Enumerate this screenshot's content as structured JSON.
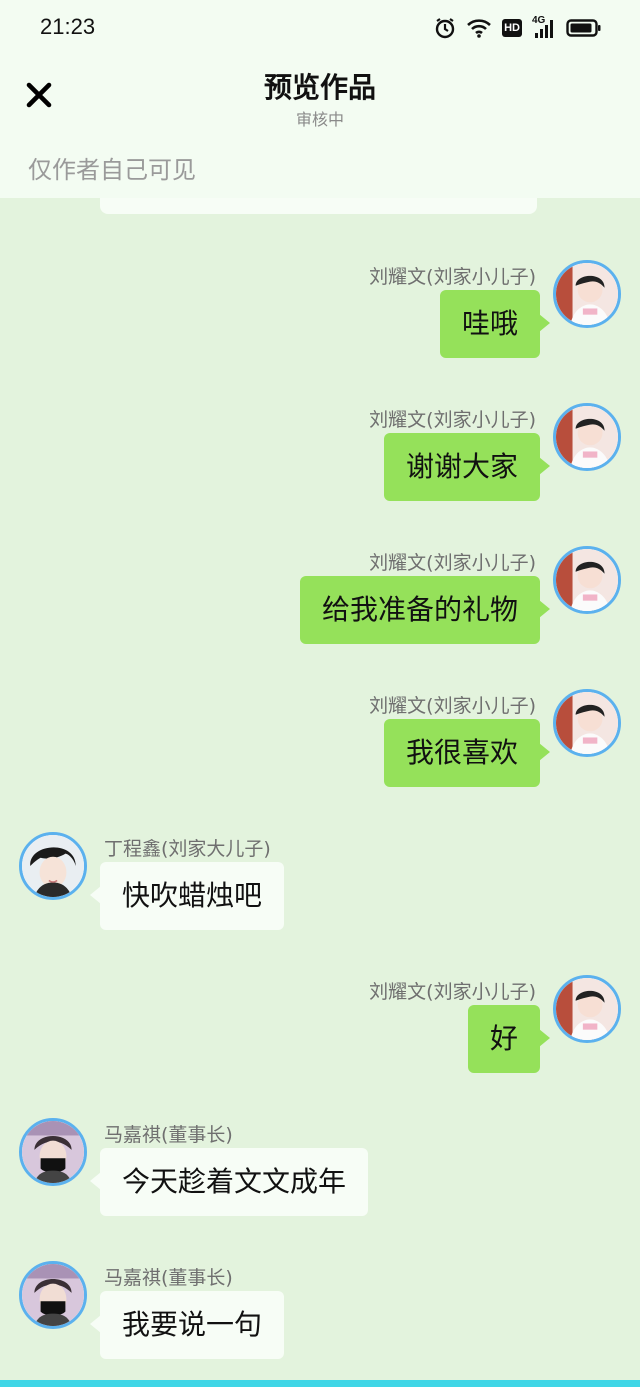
{
  "status_bar": {
    "time": "21:23",
    "icons": [
      "alarm-icon",
      "wifi-icon",
      "hd-icon",
      "4g-signal-icon",
      "battery-icon"
    ],
    "hd_label": "HD",
    "network_label": "4G"
  },
  "header": {
    "title": "预览作品",
    "subtitle": "审核中",
    "close_icon": "close-icon",
    "visibility_note": "仅作者自己可见"
  },
  "colors": {
    "header_bg": "#f3fcf2",
    "chat_bg": "#e3f3dd",
    "own_bubble": "#95e15a",
    "other_bubble": "#f7fdf6",
    "avatar_border": "#5bb1ee",
    "bottom_accent": "#3fd6e6"
  },
  "messages": [
    {
      "side": "right",
      "sender": "刘耀文(刘家小儿子)",
      "text": "哇哦",
      "avatar": "avatar-liu-yaowen"
    },
    {
      "side": "right",
      "sender": "刘耀文(刘家小儿子)",
      "text": "谢谢大家",
      "avatar": "avatar-liu-yaowen"
    },
    {
      "side": "right",
      "sender": "刘耀文(刘家小儿子)",
      "text": "给我准备的礼物",
      "avatar": "avatar-liu-yaowen"
    },
    {
      "side": "right",
      "sender": "刘耀文(刘家小儿子)",
      "text": "我很喜欢",
      "avatar": "avatar-liu-yaowen"
    },
    {
      "side": "left",
      "sender": "丁程鑫(刘家大儿子)",
      "text": "快吹蜡烛吧",
      "avatar": "avatar-ding-chengxin"
    },
    {
      "side": "right",
      "sender": "刘耀文(刘家小儿子)",
      "text": "好",
      "avatar": "avatar-liu-yaowen"
    },
    {
      "side": "left",
      "sender": "马嘉祺(董事长)",
      "text": "今天趁着文文成年",
      "avatar": "avatar-ma-jiaqi"
    },
    {
      "side": "left",
      "sender": "马嘉祺(董事长)",
      "text": "我要说一句",
      "avatar": "avatar-ma-jiaqi"
    }
  ]
}
